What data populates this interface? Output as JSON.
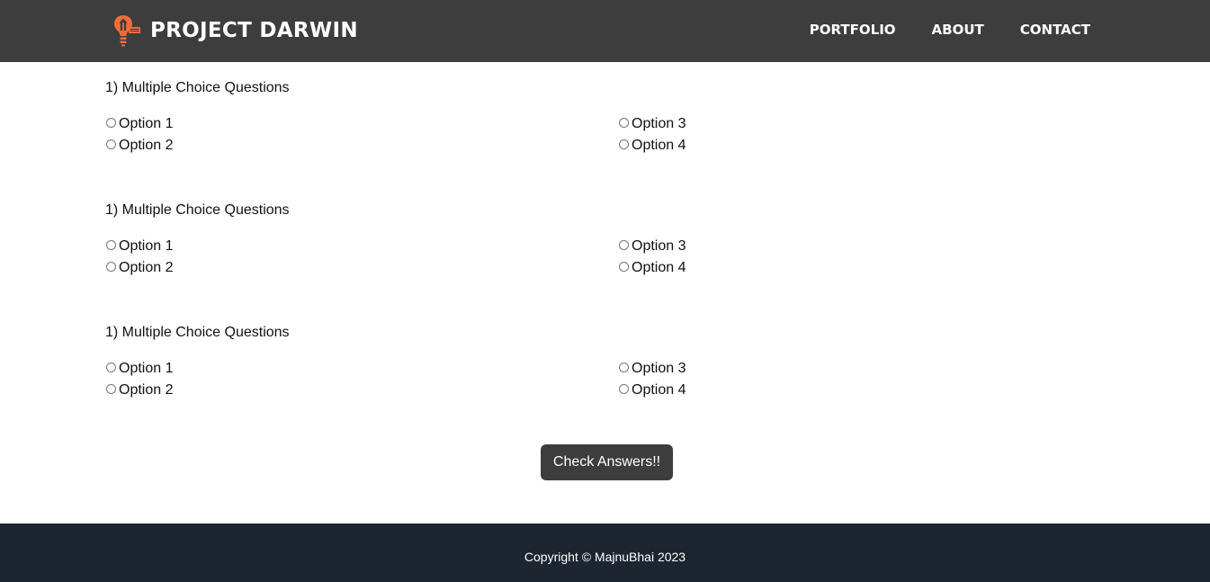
{
  "brand": {
    "title": "PROJECT DARWIN",
    "logo_icon": "lightbulb-icon",
    "logo_color": "#f26b3a"
  },
  "nav": {
    "items": [
      {
        "label": "PORTFOLIO"
      },
      {
        "label": "ABOUT"
      },
      {
        "label": "CONTACT"
      }
    ]
  },
  "quiz": {
    "questions": [
      {
        "title": "1) Multiple Choice Questions",
        "options": [
          "Option 1",
          "Option 2",
          "Option 3",
          "Option 4"
        ],
        "selected": null
      },
      {
        "title": "1) Multiple Choice Questions",
        "options": [
          "Option 1",
          "Option 2",
          "Option 3",
          "Option 4"
        ],
        "selected": null
      },
      {
        "title": "1) Multiple Choice Questions",
        "options": [
          "Option 1",
          "Option 2",
          "Option 3",
          "Option 4"
        ],
        "selected": null
      }
    ],
    "submit_label": "Check Answers!!"
  },
  "footer": {
    "copyright": "Copyright © MajnuBhai 2023"
  },
  "colors": {
    "navbar_bg": "#3d3d3d",
    "footer_bg": "#1c2530",
    "button_bg": "#3d3d3d",
    "accent": "#f26b3a"
  }
}
